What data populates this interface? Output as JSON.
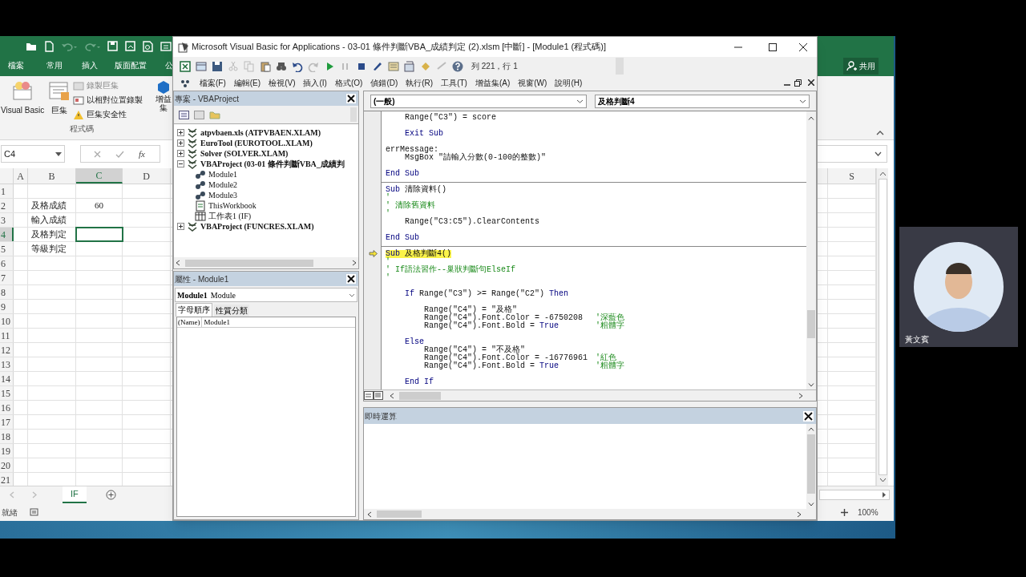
{
  "excel": {
    "ribbon_tabs": [
      {
        "label": "檔案",
        "selected": false
      },
      {
        "label": "常用",
        "selected": false
      },
      {
        "label": "插入",
        "selected": false
      },
      {
        "label": "版面配置",
        "selected": false
      },
      {
        "label": "公",
        "selected": false
      }
    ],
    "share_button": "共用",
    "ribbon_group": {
      "label": "程式碼",
      "large_buttons": [
        {
          "label": "Visual Basic",
          "kind": "vb"
        },
        {
          "label": "巨集",
          "kind": "macro"
        }
      ],
      "small_buttons": [
        {
          "label": "錄製巨集",
          "disabled": true,
          "kind": "record"
        },
        {
          "label": "以相對位置錄製",
          "disabled": false,
          "kind": "relative"
        },
        {
          "label": "巨集安全性",
          "disabled": false,
          "kind": "security"
        }
      ]
    },
    "addins_button": "增益集",
    "name_box": "C4",
    "formula_label": "fx",
    "columns": [
      {
        "label": "A",
        "selected": false
      },
      {
        "label": "B",
        "selected": false
      },
      {
        "label": "C",
        "selected": true
      },
      {
        "label": "D",
        "selected": false
      }
    ],
    "right_column": {
      "label": "S",
      "selected": false
    },
    "rows": [
      {
        "header": "1",
        "selected": false
      },
      {
        "header": "2",
        "selected": false,
        "b": "及格成績",
        "c": "60"
      },
      {
        "header": "3",
        "selected": false,
        "b": "輸入成績"
      },
      {
        "header": "4",
        "selected": true,
        "b": "及格判定"
      },
      {
        "header": "5",
        "selected": false,
        "b": "等級判定"
      },
      {
        "header": "6",
        "selected": false
      },
      {
        "header": "7",
        "selected": false
      },
      {
        "header": "8",
        "selected": false
      },
      {
        "header": "9",
        "selected": false
      },
      {
        "header": "10",
        "selected": false
      },
      {
        "header": "11",
        "selected": false
      },
      {
        "header": "12",
        "selected": false
      },
      {
        "header": "13",
        "selected": false
      },
      {
        "header": "14",
        "selected": false
      },
      {
        "header": "15",
        "selected": false
      },
      {
        "header": "16",
        "selected": false
      },
      {
        "header": "17",
        "selected": false
      },
      {
        "header": "18",
        "selected": false
      },
      {
        "header": "19",
        "selected": false
      },
      {
        "header": "20",
        "selected": false
      },
      {
        "header": "21",
        "selected": false
      }
    ],
    "sheet_tabs": [
      {
        "label": "IF",
        "selected": true
      }
    ],
    "status": "就緒",
    "zoom": "100%"
  },
  "vba": {
    "title": "Microsoft Visual Basic for Applications - 03-01 條件判斷VBA_成績判定 (2).xlsm [中斷] - [Module1 (程式碼)]",
    "position": "列 221，行 1",
    "menus": [
      "檔案(F)",
      "編輯(E)",
      "檢視(V)",
      "插入(I)",
      "格式(O)",
      "偵錯(D)",
      "執行(R)",
      "工具(T)",
      "增益集(A)",
      "視窗(W)",
      "說明(H)"
    ],
    "project": {
      "title": "專案 - VBAProject",
      "tree": [
        {
          "label": "atpvbaen.xls (ATPVBAEN.XLAM)",
          "kind": "project",
          "expanded": false
        },
        {
          "label": "EuroTool (EUROTOOL.XLAM)",
          "kind": "project",
          "expanded": false
        },
        {
          "label": "Solver (SOLVER.XLAM)",
          "kind": "project",
          "expanded": false
        },
        {
          "label": "VBAProject (03-01 條件判斷VBA_成績判",
          "kind": "project",
          "expanded": true,
          "children": [
            {
              "label": "Module1",
              "kind": "module"
            },
            {
              "label": "Module2",
              "kind": "module"
            },
            {
              "label": "Module3",
              "kind": "module"
            },
            {
              "label": "ThisWorkbook",
              "kind": "workbook"
            },
            {
              "label": "工作表1 (IF)",
              "kind": "sheet"
            }
          ]
        },
        {
          "label": "VBAProject (FUNCRES.XLAM)",
          "kind": "project",
          "expanded": false
        }
      ]
    },
    "properties": {
      "title": "屬性 - Module1",
      "object": "Module1",
      "object_type": "Module",
      "tabs": [
        {
          "label": "字母順序",
          "selected": true
        },
        {
          "label": "性質分類",
          "selected": false
        }
      ],
      "rows": [
        {
          "name": "(Name)",
          "value": "Module1"
        }
      ]
    },
    "code": {
      "object": "(一般)",
      "procedure": "及格判斷4",
      "lines": [
        {
          "kind": "text",
          "parts": [
            {
              "kind": "plain",
              "text": "    Range(\"C3\") = score"
            }
          ]
        },
        {
          "kind": "blank"
        },
        {
          "kind": "text",
          "parts": [
            {
              "kind": "keyword",
              "text": "    Exit Sub"
            }
          ]
        },
        {
          "kind": "blank"
        },
        {
          "kind": "text",
          "parts": [
            {
              "kind": "plain",
              "text": "errMessage:"
            }
          ]
        },
        {
          "kind": "text",
          "parts": [
            {
              "kind": "plain",
              "text": "    MsgBox \"請輸入分數(0-100的整數)\""
            }
          ]
        },
        {
          "kind": "blank"
        },
        {
          "kind": "text",
          "parts": [
            {
              "kind": "keyword",
              "text": "End Sub"
            }
          ]
        },
        {
          "kind": "separator"
        },
        {
          "kind": "text",
          "parts": [
            {
              "kind": "keyword",
              "text": "Sub"
            },
            {
              "kind": "plain",
              "text": " 清除資料()"
            }
          ]
        },
        {
          "kind": "text",
          "parts": [
            {
              "kind": "comment",
              "text": "'"
            }
          ]
        },
        {
          "kind": "text",
          "parts": [
            {
              "kind": "comment",
              "text": "' 清除舊資料"
            }
          ]
        },
        {
          "kind": "text",
          "parts": [
            {
              "kind": "comment",
              "text": "'"
            }
          ]
        },
        {
          "kind": "text",
          "parts": [
            {
              "kind": "plain",
              "text": "    Range(\"C3:C5\").ClearContents"
            }
          ]
        },
        {
          "kind": "blank"
        },
        {
          "kind": "text",
          "parts": [
            {
              "kind": "keyword",
              "text": "End Sub"
            }
          ]
        },
        {
          "kind": "separator"
        },
        {
          "kind": "execution_point",
          "parts": [
            {
              "kind": "keyword",
              "text": "Sub"
            },
            {
              "kind": "plain",
              "text": " 及格判斷4()"
            }
          ]
        },
        {
          "kind": "text",
          "parts": [
            {
              "kind": "comment",
              "text": "'"
            }
          ]
        },
        {
          "kind": "text",
          "parts": [
            {
              "kind": "comment",
              "text": "' If語法習作--巢狀判斷句ElseIf"
            }
          ]
        },
        {
          "kind": "text",
          "parts": [
            {
              "kind": "comment",
              "text": "'"
            }
          ]
        },
        {
          "kind": "blank"
        },
        {
          "kind": "text",
          "parts": [
            {
              "kind": "keyword",
              "text": "    If"
            },
            {
              "kind": "plain",
              "text": " Range(\"C3\") >= Range(\"C2\") "
            },
            {
              "kind": "keyword",
              "text": "Then"
            }
          ]
        },
        {
          "kind": "blank"
        },
        {
          "kind": "text",
          "parts": [
            {
              "kind": "plain",
              "text": "        Range(\"C4\") = \"及格\""
            }
          ]
        },
        {
          "kind": "text",
          "parts": [
            {
              "kind": "plain",
              "text": "        Range(\"C4\").Font.Color = -6750208"
            },
            {
              "kind": "note",
              "text": "'深藍色"
            }
          ]
        },
        {
          "kind": "text",
          "parts": [
            {
              "kind": "plain",
              "text": "        Range(\"C4\").Font.Bold = "
            },
            {
              "kind": "keyword",
              "text": "True"
            },
            {
              "kind": "note",
              "text": "'粗體字"
            }
          ]
        },
        {
          "kind": "blank"
        },
        {
          "kind": "text",
          "parts": [
            {
              "kind": "keyword",
              "text": "    Else"
            }
          ]
        },
        {
          "kind": "text",
          "parts": [
            {
              "kind": "plain",
              "text": "        Range(\"C4\") = \"不及格\""
            }
          ]
        },
        {
          "kind": "text",
          "parts": [
            {
              "kind": "plain",
              "text": "        Range(\"C4\").Font.Color = -16776961"
            },
            {
              "kind": "note",
              "text": "'紅色"
            }
          ]
        },
        {
          "kind": "text",
          "parts": [
            {
              "kind": "plain",
              "text": "        Range(\"C4\").Font.Bold = "
            },
            {
              "kind": "keyword",
              "text": "True"
            },
            {
              "kind": "note",
              "text": "'粗體字"
            }
          ]
        },
        {
          "kind": "blank"
        },
        {
          "kind": "text",
          "parts": [
            {
              "kind": "keyword",
              "text": "    End If"
            }
          ]
        }
      ]
    },
    "immediate": {
      "title": "即時運算"
    }
  },
  "webcam": {
    "name": "黃文賓"
  }
}
